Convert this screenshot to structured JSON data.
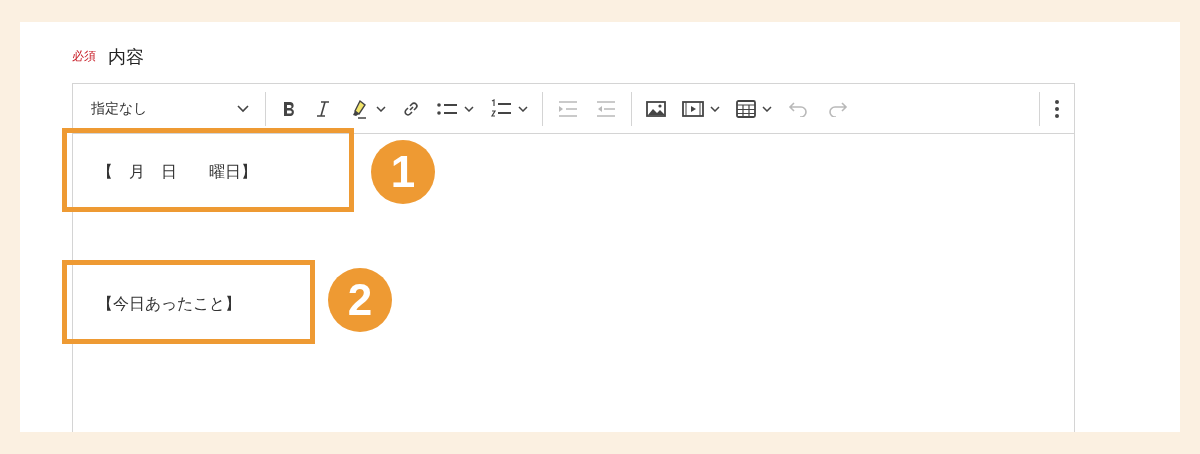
{
  "field": {
    "required_badge": "必須",
    "label": "内容"
  },
  "toolbar": {
    "format_select": "指定なし",
    "tools": [
      {
        "kind": "bold",
        "dropdown": false,
        "disabled": false
      },
      {
        "kind": "italic",
        "dropdown": false,
        "disabled": false
      },
      {
        "kind": "highlight",
        "dropdown": true,
        "disabled": false
      },
      {
        "kind": "link",
        "dropdown": false,
        "disabled": false
      },
      {
        "kind": "bullets",
        "dropdown": true,
        "disabled": false
      },
      {
        "kind": "numbers",
        "dropdown": true,
        "disabled": false
      },
      {
        "kind": "sep"
      },
      {
        "kind": "indent",
        "dropdown": false,
        "disabled": true
      },
      {
        "kind": "outdent",
        "dropdown": false,
        "disabled": true
      },
      {
        "kind": "sep"
      },
      {
        "kind": "image",
        "dropdown": false,
        "disabled": false
      },
      {
        "kind": "media",
        "dropdown": true,
        "disabled": false
      },
      {
        "kind": "table",
        "dropdown": true,
        "disabled": false
      },
      {
        "kind": "undo",
        "dropdown": false,
        "disabled": true
      },
      {
        "kind": "redo",
        "dropdown": false,
        "disabled": true
      },
      {
        "kind": "spacer"
      },
      {
        "kind": "more",
        "dropdown": false,
        "disabled": false
      }
    ]
  },
  "content": [
    "【　月　日　　曜日】",
    "【今日あったこと】"
  ],
  "annotations": [
    {
      "number": "1"
    },
    {
      "number": "2"
    }
  ]
}
